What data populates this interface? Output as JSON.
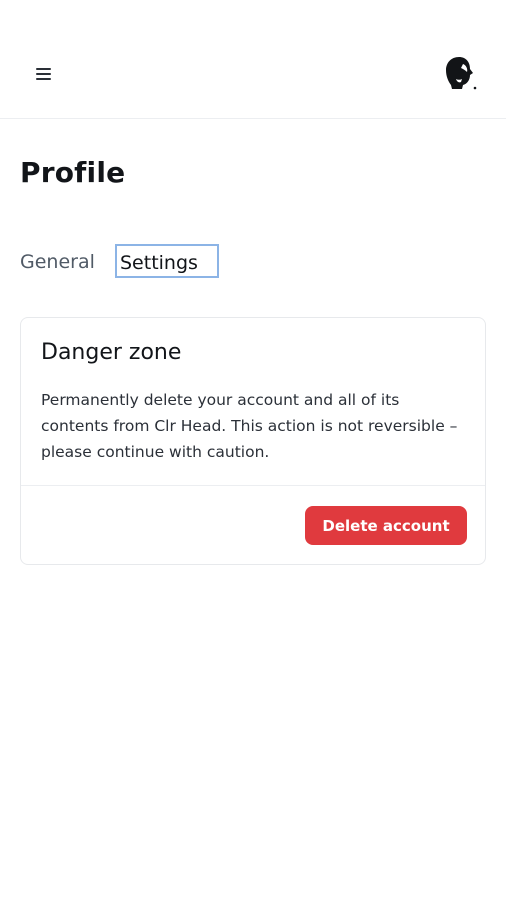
{
  "header": {
    "menu_icon": "hamburger-menu-icon",
    "avatar_icon": "user-avatar-silhouette"
  },
  "page": {
    "title": "Profile"
  },
  "tabs": [
    {
      "label": "General",
      "selected": false
    },
    {
      "label": "Settings",
      "selected": true
    }
  ],
  "danger_zone": {
    "title": "Danger zone",
    "description": "Permanently delete your account and all of its contents from Clr Head. This action is not reversible – please continue with caution.",
    "delete_button_label": "Delete account"
  },
  "colors": {
    "danger": "#e03a3e",
    "focus_outline": "#8cb4e6",
    "divider": "#eceef1"
  }
}
